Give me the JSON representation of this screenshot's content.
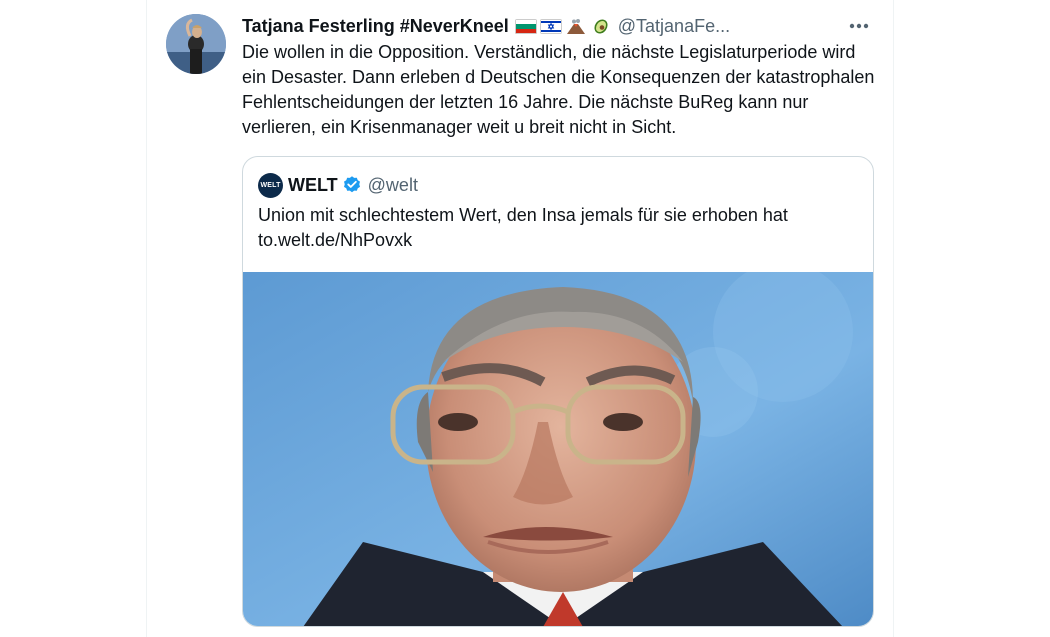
{
  "tweet": {
    "display_name": "Tatjana Festerling #NeverKneel",
    "flag_icons": [
      "bulgaria-flag-icon",
      "israel-flag-icon",
      "volcano-icon",
      "avocado-icon"
    ],
    "handle": "@TatjanaFe...",
    "text": "Die wollen in die Opposition. Verständlich, die nächste Legislaturperiode wird ein Desaster. Dann erleben d Deutschen die Konsequenzen der katastrophalen Fehlentscheidungen der letzten 16 Jahre. Die nächste BuReg kann nur verlieren, ein Krisenmanager weit u breit nicht in Sicht."
  },
  "quote": {
    "avatar_label": "WELT",
    "name": "WELT",
    "handle": "@welt",
    "text": "Union mit schlechtestem Wert, den Insa jemals für sie erhoben hat",
    "link": "to.welt.de/NhPovxk"
  },
  "colors": {
    "text_primary": "#0f1419",
    "text_secondary": "#536471",
    "verified_blue": "#1d9bf0",
    "border": "#cfd9de",
    "image_background": "#6fa8dc"
  }
}
